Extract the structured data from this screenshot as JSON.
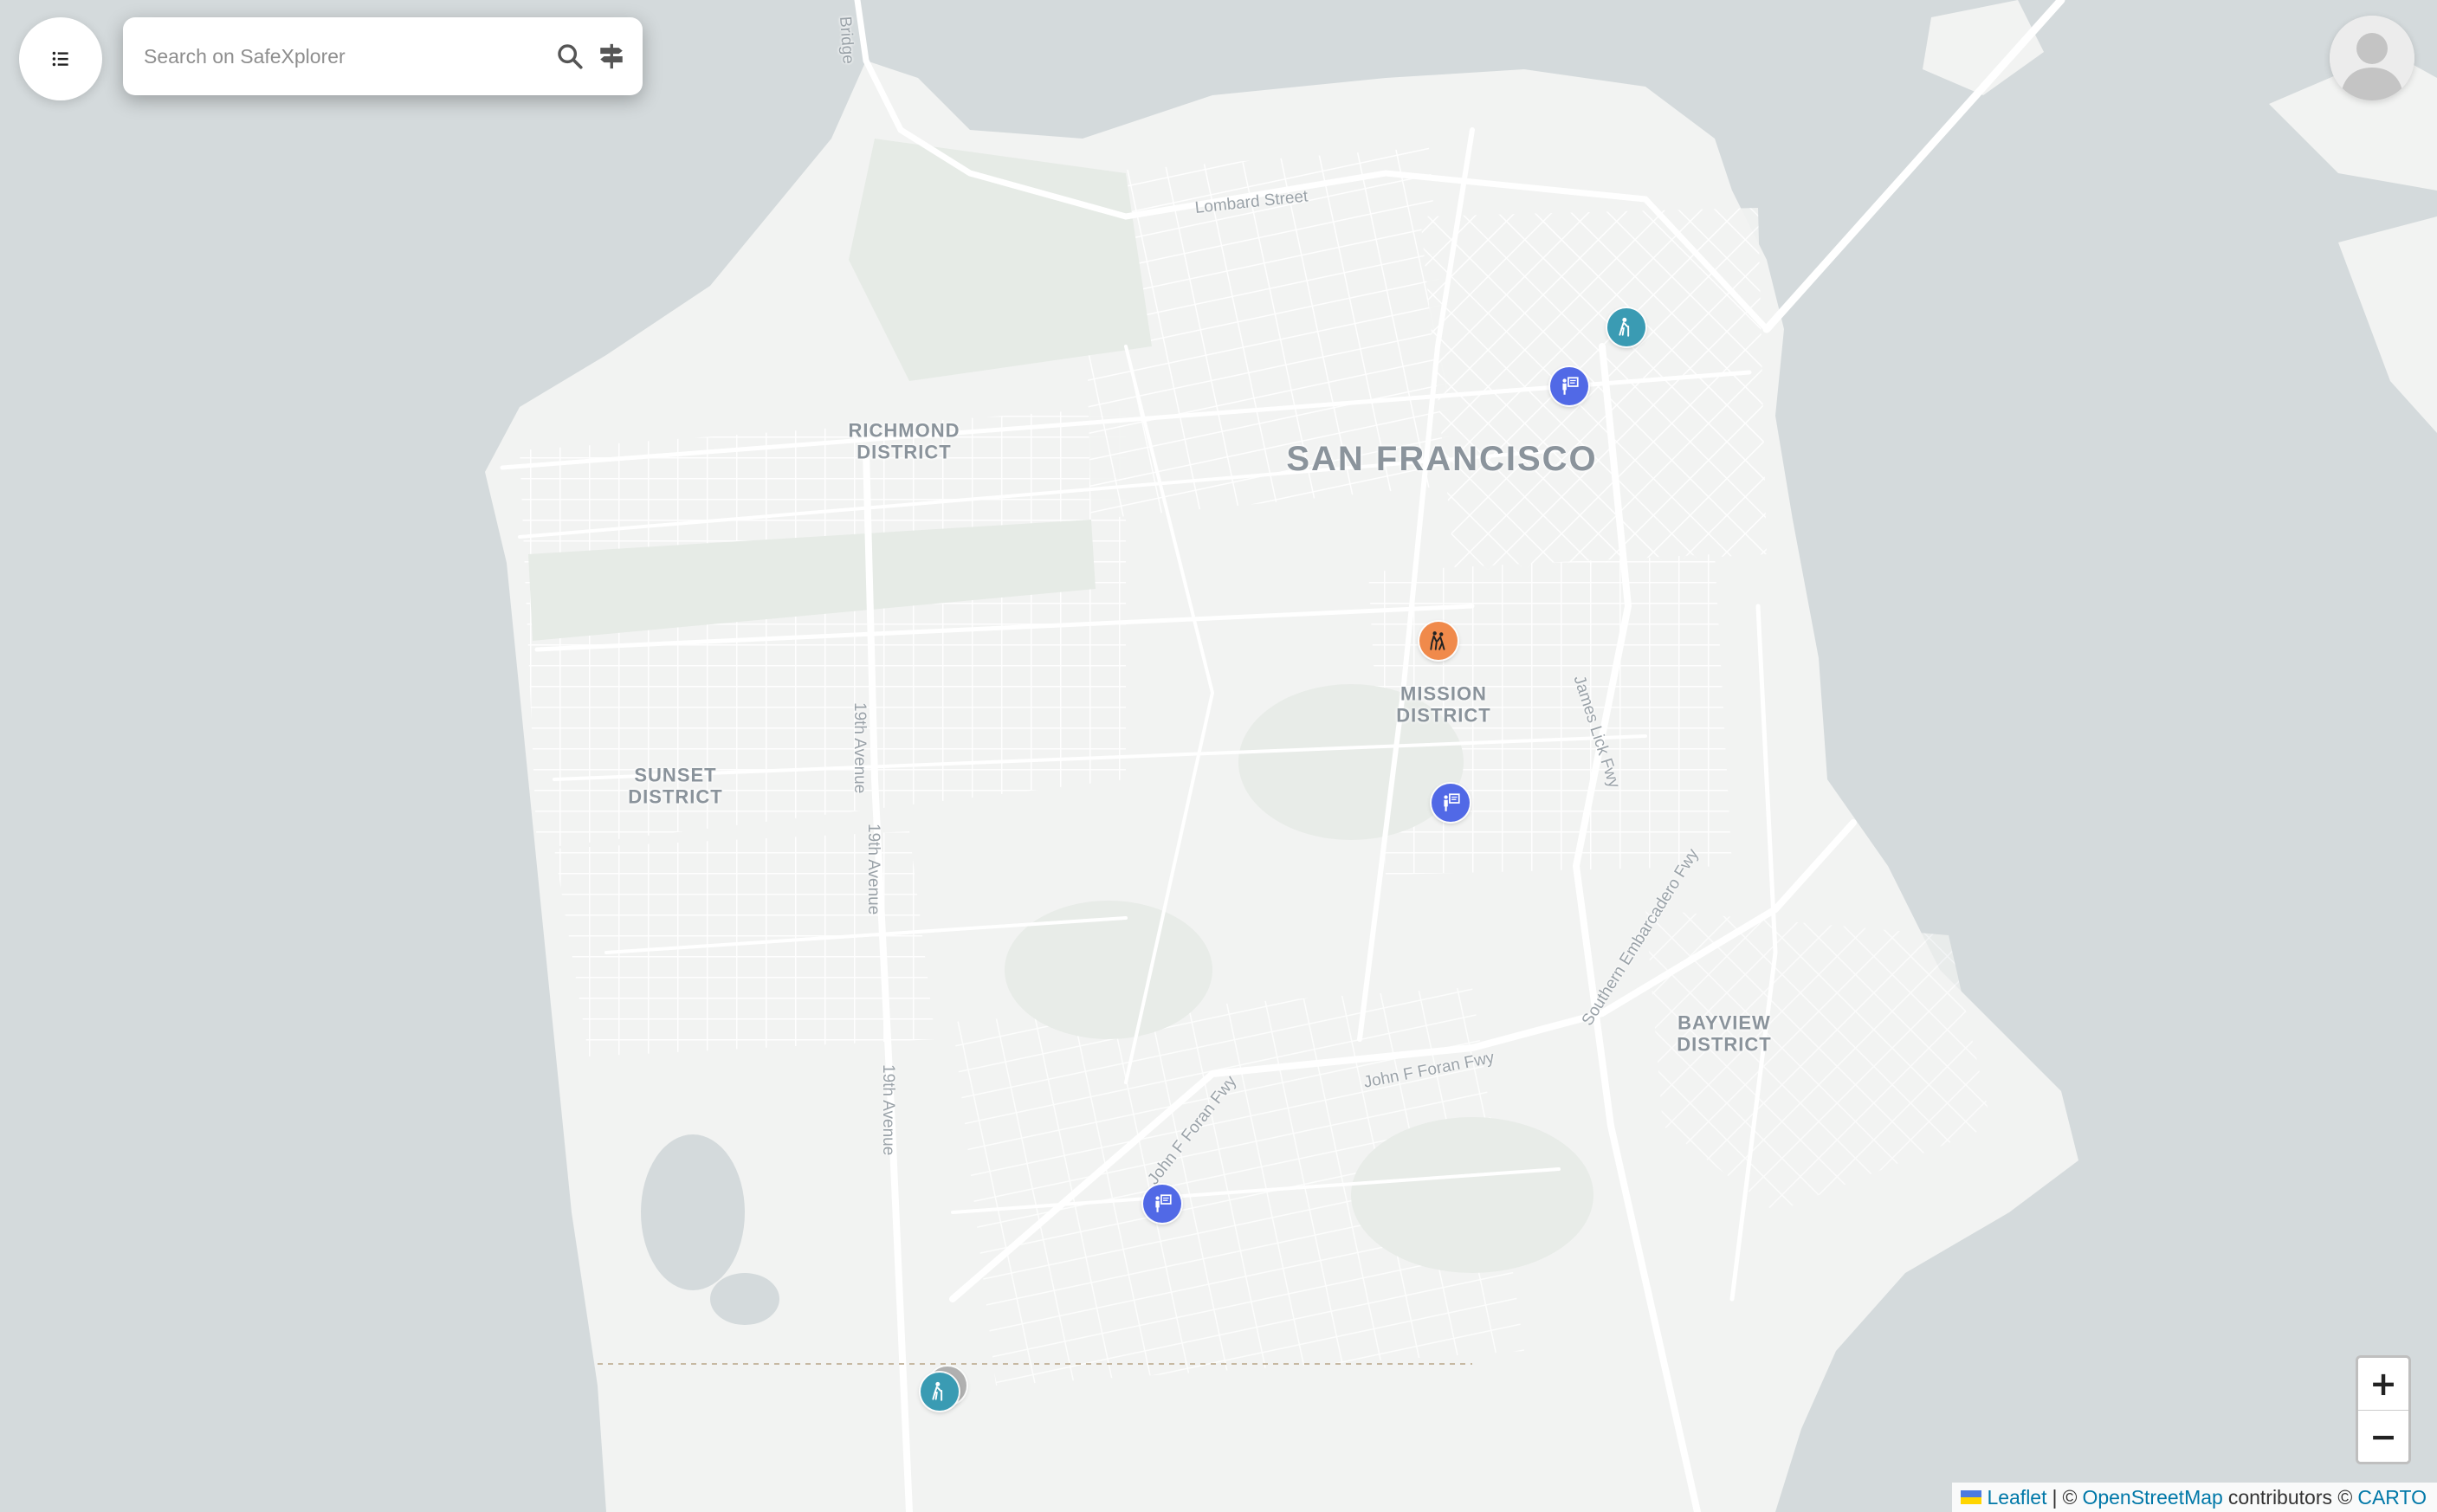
{
  "search": {
    "placeholder": "Search on SafeXplorer"
  },
  "icons": {
    "menu": "list-icon",
    "search": "search-icon",
    "filter": "signpost-icon",
    "avatar": "user-avatar-icon"
  },
  "map": {
    "city_label": "SAN FRANCISCO",
    "districts": [
      {
        "name": "RICHMOND\nDISTRICT"
      },
      {
        "name": "SUNSET\nDISTRICT"
      },
      {
        "name": "MISSION\nDISTRICT"
      },
      {
        "name": "BAYVIEW\nDISTRICT"
      }
    ],
    "streets": [
      {
        "name": "Lombard Street"
      },
      {
        "name": "19th Avenue"
      },
      {
        "name": "19th Avenue"
      },
      {
        "name": "19th Avenue"
      },
      {
        "name": "John F Foran Fwy"
      },
      {
        "name": "John F Foran Fwy"
      },
      {
        "name": "James Lick Fwy"
      },
      {
        "name": "Southern Embarcadero Fwy"
      },
      {
        "name": "Bridge"
      }
    ],
    "markers": [
      {
        "type": "teal",
        "icon": "cane-person-icon",
        "color": "#3a9bb3"
      },
      {
        "type": "blue",
        "icon": "presentation-icon",
        "color": "#5169e6"
      },
      {
        "type": "orange",
        "icon": "people-pushing-icon",
        "color": "#f08a4b"
      },
      {
        "type": "blue",
        "icon": "presentation-icon",
        "color": "#5169e6"
      },
      {
        "type": "blue",
        "icon": "presentation-icon",
        "color": "#5169e6"
      },
      {
        "type": "teal",
        "icon": "cane-person-icon",
        "color": "#3a9bb3"
      }
    ]
  },
  "zoom": {
    "in": "+",
    "out": "−"
  },
  "attribution": {
    "leaflet": "Leaflet",
    "sep": "|",
    "copy": "©",
    "osm": "OpenStreetMap",
    "contributors": "contributors ©",
    "carto": "CARTO"
  },
  "colors": {
    "water": "#d4dadc",
    "land": "#f2f3f2",
    "road": "#ffffff",
    "park": "#e6ebe6",
    "marker_blue": "#5169e6",
    "marker_teal": "#3a9bb3",
    "marker_orange": "#f08a4b",
    "link": "#0078a8"
  }
}
